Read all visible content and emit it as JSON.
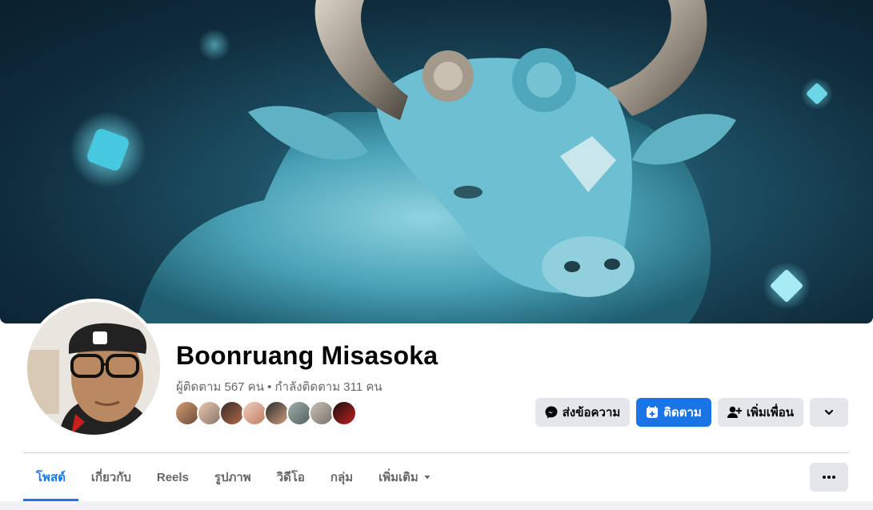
{
  "profile": {
    "name": "Boonruang Misasoka",
    "stats": "ผู้ติดตาม 567 คน • กำลังติดตาม 311 คน"
  },
  "actions": {
    "message_label": "ส่งข้อความ",
    "follow_label": "ติดตาม",
    "add_friend_label": "เพิ่มเพื่อน",
    "message_icon": "messenger-icon",
    "follow_icon": "follow-icon",
    "add_friend_icon": "add-friend-icon",
    "dropdown_icon": "chevron-down-icon"
  },
  "tabs": [
    {
      "label": "โพสต์",
      "active": true
    },
    {
      "label": "เกี่ยวกับ",
      "active": false
    },
    {
      "label": "Reels",
      "active": false
    },
    {
      "label": "รูปภาพ",
      "active": false
    },
    {
      "label": "วิดีโอ",
      "active": false
    },
    {
      "label": "กลุ่ม",
      "active": false
    },
    {
      "label": "เพิ่มเติม",
      "active": false
    }
  ],
  "friend_avatars": 8,
  "colors": {
    "accent": "#1877f2",
    "primary_button": "#1b74e4",
    "secondary_button": "#e4e6eb",
    "secondary_text": "#65676b"
  }
}
